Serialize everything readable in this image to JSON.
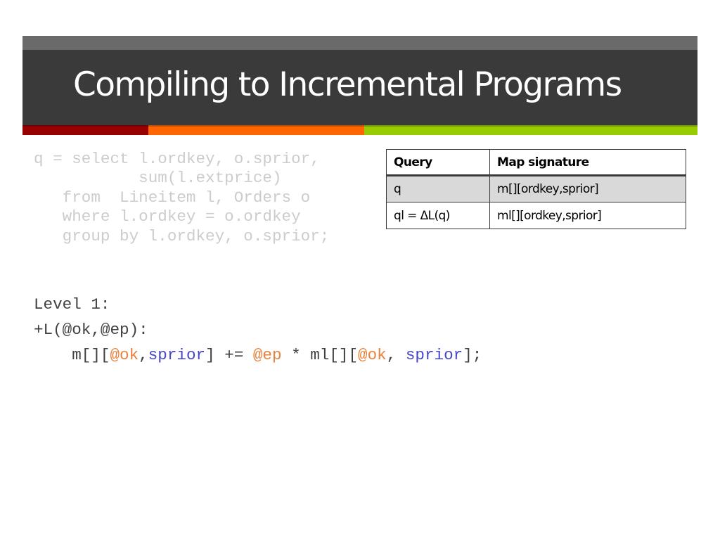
{
  "slide": {
    "title": "Compiling to Incremental Programs",
    "accent_colors": {
      "header_top": "#6a6a6a",
      "header_main": "#3a3a3a",
      "red": "#990000",
      "orange": "#ff6600",
      "green": "#99cc00"
    }
  },
  "query_code": {
    "lines": [
      "q = select l.ordkey, o.sprior,",
      "           sum(l.extprice)",
      "   from  Lineitem l, Orders o",
      "   where l.ordkey = o.ordkey",
      "   group by l.ordkey, o.sprior;"
    ]
  },
  "table": {
    "headers": [
      "Query",
      "Map signature"
    ],
    "rows": [
      [
        "q",
        "m[][ordkey,sprior]"
      ],
      [
        "ql = ΔL(q)",
        "ml[][ordkey,sprior]"
      ]
    ]
  },
  "level_code": {
    "level_label": "Level 1:",
    "trigger": "+L(@ok,@ep):",
    "statement_tokens": [
      {
        "text": "    m[][",
        "style": "plain"
      },
      {
        "text": "@ok",
        "style": "orange"
      },
      {
        "text": ",",
        "style": "plain"
      },
      {
        "text": "sprior",
        "style": "blue"
      },
      {
        "text": "] += ",
        "style": "plain"
      },
      {
        "text": "@ep",
        "style": "orange"
      },
      {
        "text": " * ml[][",
        "style": "plain"
      },
      {
        "text": "@ok",
        "style": "orange"
      },
      {
        "text": ", ",
        "style": "plain"
      },
      {
        "text": "sprior",
        "style": "blue"
      },
      {
        "text": "];",
        "style": "plain"
      }
    ],
    "colors": {
      "orange": "#e8823a",
      "blue": "#4646c8",
      "plain": "#404040"
    }
  }
}
